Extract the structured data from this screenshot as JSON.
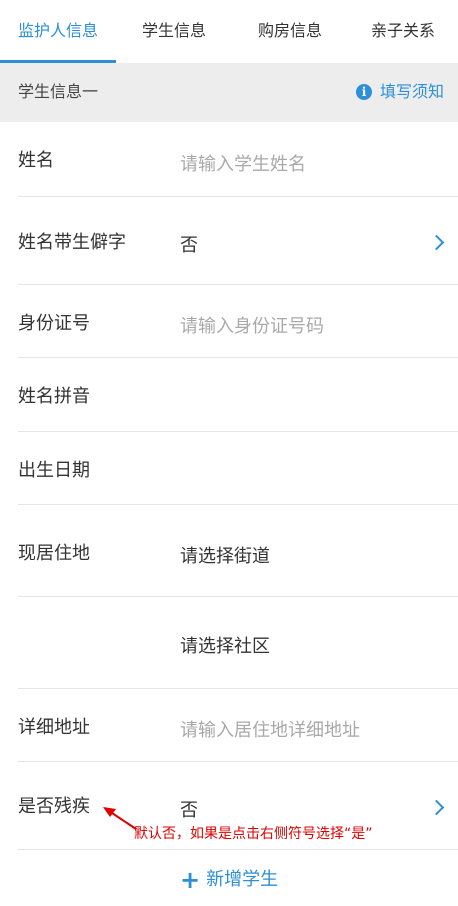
{
  "tabs": [
    {
      "label": "监护人信息",
      "active": true
    },
    {
      "label": "学生信息",
      "active": false
    },
    {
      "label": "购房信息",
      "active": false
    },
    {
      "label": "亲子关系",
      "active": false
    }
  ],
  "section": {
    "title": "学生信息一",
    "notice_label": "填写须知"
  },
  "form": {
    "name": {
      "label": "姓名",
      "placeholder": "请输入学生姓名"
    },
    "rare_char": {
      "label": "姓名带生僻字",
      "value": "否"
    },
    "id_number": {
      "label": "身份证号",
      "placeholder": "请输入身份证号码"
    },
    "pinyin": {
      "label": "姓名拼音"
    },
    "birth_date": {
      "label": "出生日期"
    },
    "residence": {
      "label": "现居住地",
      "street_placeholder": "请选择街道",
      "community_placeholder": "请选择社区"
    },
    "address": {
      "label": "详细地址",
      "placeholder": "请输入居住地详细地址"
    },
    "disability": {
      "label": "是否残疾",
      "value": "否"
    }
  },
  "add_student_label": "新增学生",
  "annotation_text": "默认否，如果是点击右侧符号选择“是”",
  "colors": {
    "accent": "#2d8fd5",
    "annotation": "#e00000",
    "section_bg": "#ededed"
  }
}
